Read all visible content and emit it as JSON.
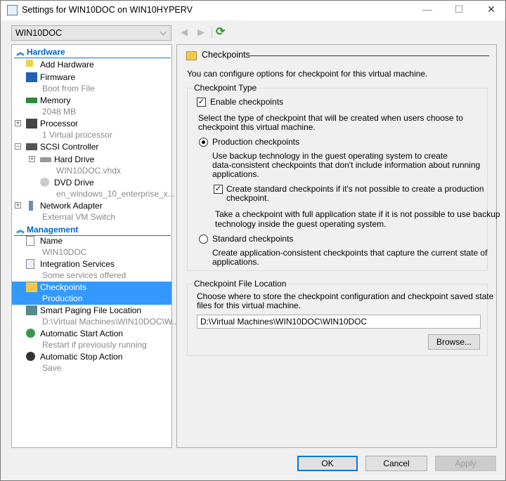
{
  "window": {
    "title": "Settings for WIN10DOC on WIN10HYPERV",
    "minimize": "—",
    "maximize": "☐",
    "close": "✕"
  },
  "vm_selector": {
    "value": "WIN10DOC"
  },
  "tree": {
    "hardware_header": "Hardware",
    "management_header": "Management",
    "items": [
      {
        "label": "Add Hardware",
        "sub": ""
      },
      {
        "label": "Firmware",
        "sub": "Boot from File"
      },
      {
        "label": "Memory",
        "sub": "2048 MB"
      },
      {
        "label": "Processor",
        "sub": "1 Virtual processor"
      },
      {
        "label": "SCSI Controller",
        "sub": ""
      },
      {
        "label": "Hard Drive",
        "sub": "WIN10DOC.vhdx"
      },
      {
        "label": "DVD Drive",
        "sub": "en_windows_10_enterprise_x..."
      },
      {
        "label": "Network Adapter",
        "sub": "External VM Switch"
      },
      {
        "label": "Name",
        "sub": "WIN10DOC"
      },
      {
        "label": "Integration Services",
        "sub": "Some services offered"
      },
      {
        "label": "Checkpoints",
        "sub": "Production"
      },
      {
        "label": "Smart Paging File Location",
        "sub": "D:\\Virtual Machines\\WIN10DOC\\W..."
      },
      {
        "label": "Automatic Start Action",
        "sub": "Restart if previously running"
      },
      {
        "label": "Automatic Stop Action",
        "sub": "Save"
      }
    ]
  },
  "panel": {
    "title": "Checkpoints",
    "intro": "You can configure options for checkpoint for this virtual machine.",
    "type_group": "Checkpoint Type",
    "enable_label": "Enable checkpoints",
    "enable_checked": true,
    "select_desc_1": "Select the type of checkpoint that will be created when users choose to",
    "select_desc_2": "checkpoint this virtual machine.",
    "production_label": "Production checkpoints",
    "production_desc_1": "Use backup technology in the guest operating system to create",
    "production_desc_2": "data-consistent checkpoints that don't include information about running",
    "production_desc_3": "applications.",
    "fallback_label_1": "Create standard checkpoints if it's not possible to create a production",
    "fallback_label_2": "checkpoint.",
    "fallback_checked": true,
    "fallback_desc_1": "Take a checkpoint with full application state if it is not possible to use backup",
    "fallback_desc_2": "technology inside the guest operating system.",
    "standard_label": "Standard checkpoints",
    "standard_desc_1": "Create application-consistent checkpoints that capture the current state of",
    "standard_desc_2": "applications.",
    "location_group": "Checkpoint File Location",
    "location_desc_1": "Choose where to store the checkpoint configuration and checkpoint saved state",
    "location_desc_2": "files for this virtual machine.",
    "location_value": "D:\\Virtual Machines\\WIN10DOC\\WIN10DOC",
    "browse": "Browse..."
  },
  "buttons": {
    "ok": "OK",
    "cancel": "Cancel",
    "apply": "Apply"
  }
}
